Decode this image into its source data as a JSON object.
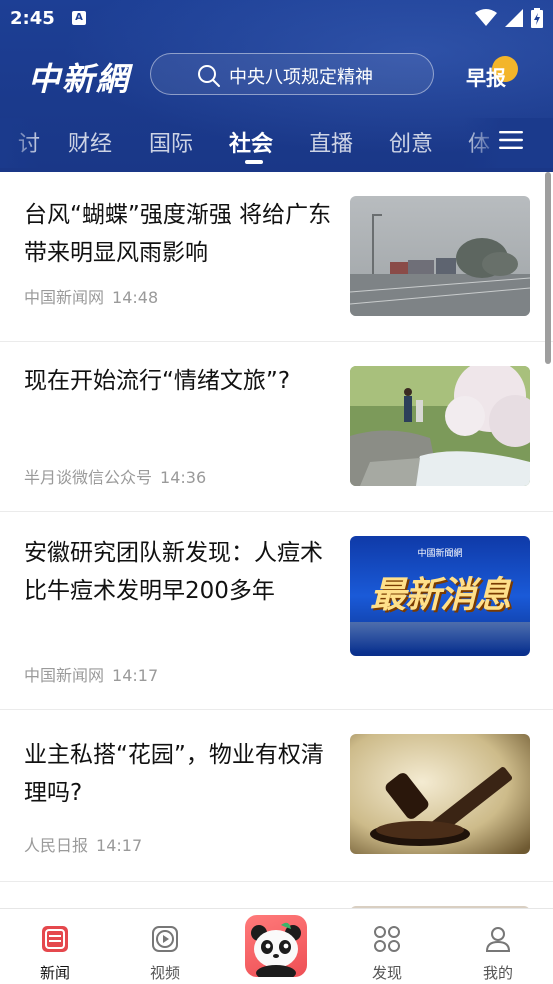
{
  "status_bar": {
    "time": "2:45",
    "notif_letter": "A"
  },
  "header": {
    "logo": "中新網",
    "search_placeholder": "中央八项规定精神",
    "morning_report": "早报",
    "tabs": [
      {
        "label": "讨",
        "active": false
      },
      {
        "label": "财经",
        "active": false
      },
      {
        "label": "国际",
        "active": false
      },
      {
        "label": "社会",
        "active": true
      },
      {
        "label": "直播",
        "active": false
      },
      {
        "label": "创意",
        "active": false
      },
      {
        "label": "体",
        "active": false
      }
    ]
  },
  "feed": {
    "items": [
      {
        "title": "台风“蝴蝶”强度渐强 将给广东带来明显风雨影响",
        "source": "中国新闻网",
        "time": "14:48",
        "thumb": "storm-highway-image"
      },
      {
        "title": "现在开始流行“情绪文旅”?",
        "source": "半月谈微信公众号",
        "time": "14:36",
        "thumb": "spring-waterfall-image"
      },
      {
        "title": "安徽研究团队新发现：人痘术比牛痘术发明早200多年",
        "source": "中国新闻网",
        "time": "14:17",
        "thumb": "breaking-news-banner",
        "thumb_caption": "最新消息",
        "thumb_brand": "中國新聞網"
      },
      {
        "title": "业主私搭“花园”，物业有权清理吗?",
        "source": "人民日报",
        "time": "14:17",
        "thumb": "gavel-image"
      }
    ]
  },
  "bottom_nav": [
    {
      "label": "新闻",
      "icon": "news-icon",
      "active": true
    },
    {
      "label": "视频",
      "icon": "video-icon",
      "active": false
    },
    {
      "label": "",
      "icon": "panda-mascot-icon",
      "active": false
    },
    {
      "label": "发现",
      "icon": "discover-icon",
      "active": false
    },
    {
      "label": "我的",
      "icon": "profile-icon",
      "active": false
    }
  ],
  "colors": {
    "brand_blue": "#1b3a8c",
    "accent_red": "#e5484d",
    "badge_yellow": "#f3b52a"
  }
}
